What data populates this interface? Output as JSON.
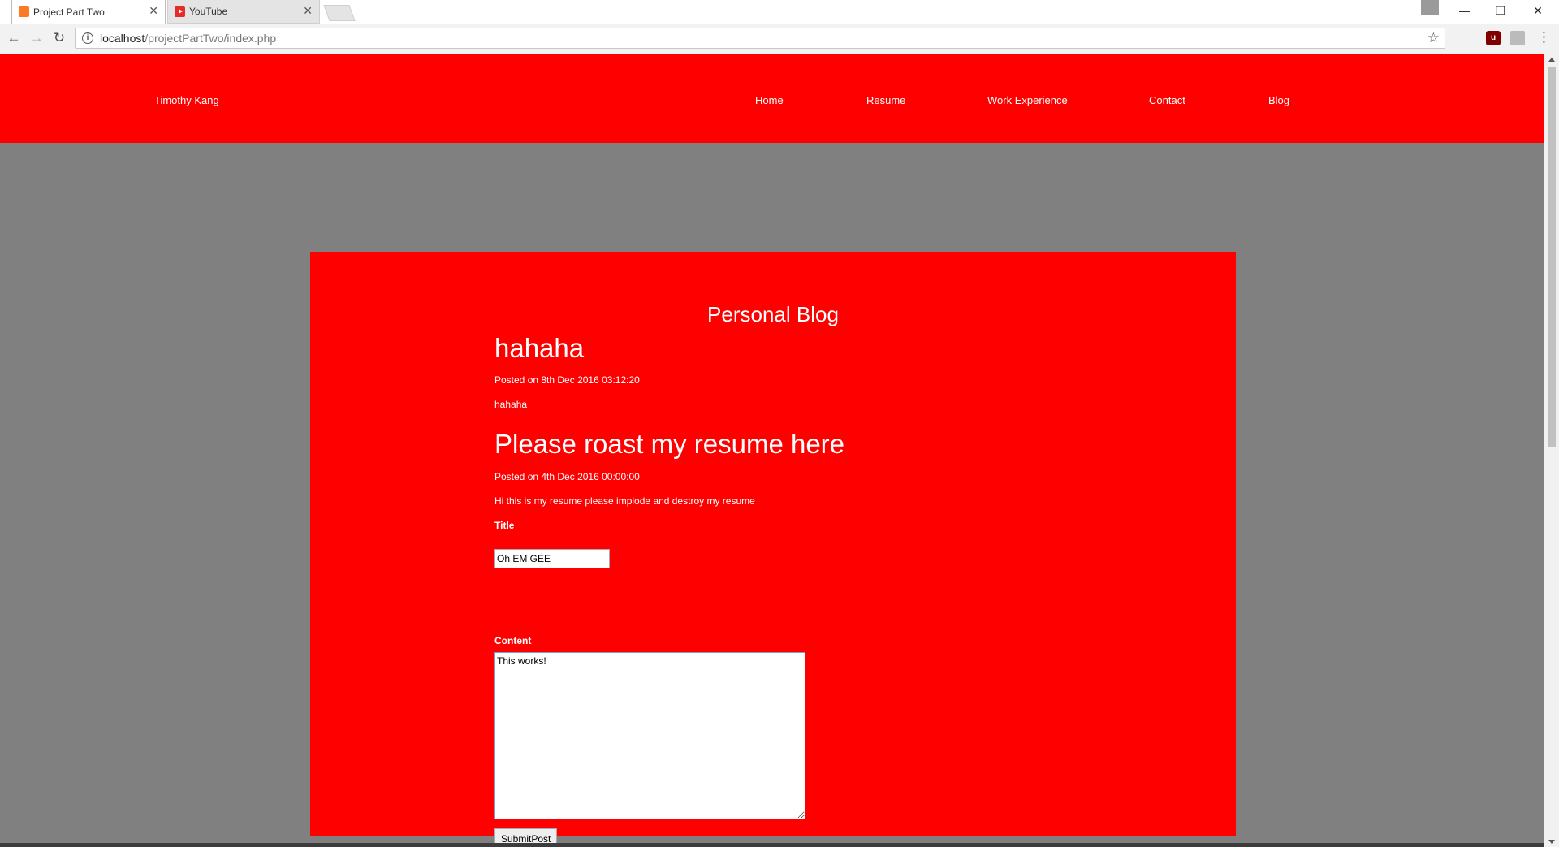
{
  "browser": {
    "tabs": [
      {
        "title": "Project Part Two",
        "icon": "xampp-icon",
        "close": "✕"
      },
      {
        "title": "YouTube",
        "icon": "youtube-icon",
        "close": "✕"
      }
    ],
    "url_host": "localhost",
    "url_path": "/projectPartTwo/index.php",
    "window_controls": {
      "minimize": "—",
      "restore": "❐",
      "close": "✕"
    },
    "nav": {
      "back": "←",
      "forward": "→",
      "reload": "↻"
    },
    "star": "☆",
    "menu": "⋮"
  },
  "site": {
    "name": "Timothy Kang",
    "nav": [
      "Home",
      "Resume",
      "Work Experience",
      "Contact",
      "Blog"
    ],
    "colors": {
      "brand": "#ff0000",
      "background": "#808080"
    }
  },
  "blog": {
    "heading": "Personal Blog",
    "posts": [
      {
        "title": "hahaha",
        "meta": "Posted on 8th Dec 2016 03:12:20",
        "body": "hahaha"
      },
      {
        "title": "Please roast my resume here",
        "meta": "Posted on 4th Dec 2016 00:00:00",
        "body": "Hi this is my resume please implode and destroy my resume"
      }
    ],
    "form": {
      "title_label": "Title",
      "title_value": "Oh EM GEE",
      "content_label": "Content",
      "content_value": "This works!",
      "submit_label": "SubmitPost"
    }
  }
}
